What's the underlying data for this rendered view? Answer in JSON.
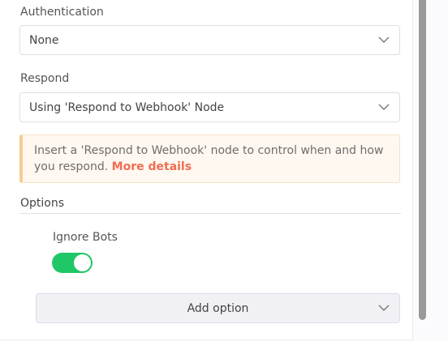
{
  "authentication": {
    "label": "Authentication",
    "value": "None"
  },
  "respond": {
    "label": "Respond",
    "value": "Using 'Respond to Webhook' Node"
  },
  "notice": {
    "text": "Insert a 'Respond to Webhook' node to control when and how you respond.",
    "link": "More details"
  },
  "options": {
    "title": "Options",
    "items": [
      {
        "label": "Ignore Bots",
        "enabled": true
      }
    ],
    "add_label": "Add option"
  },
  "colors": {
    "toggle_on": "#20c767",
    "link": "#ef6e52",
    "notice_border": "#f5cc91"
  },
  "icons": [
    "chevron-down-icon"
  ]
}
